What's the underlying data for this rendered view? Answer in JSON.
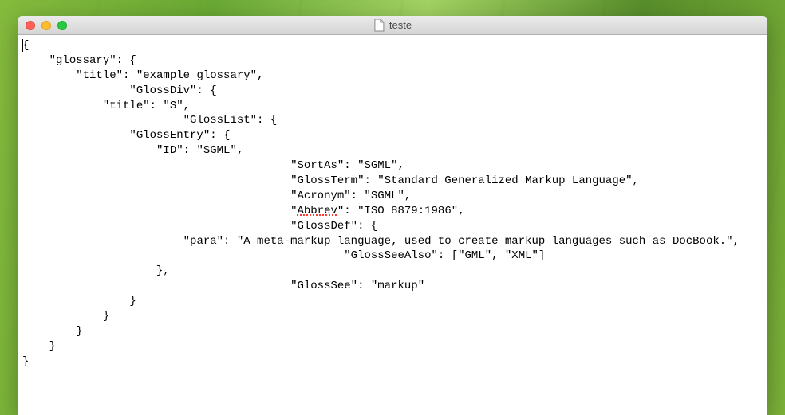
{
  "window": {
    "title": "teste"
  },
  "editor": {
    "lines": [
      "{",
      "    \"glossary\": {",
      "        \"title\": \"example glossary\",",
      "\t\t\"GlossDiv\": {",
      "            \"title\": \"S\",",
      "\t\t\t\"GlossList\": {",
      "                \"GlossEntry\": {",
      "                    \"ID\": \"SGML\",",
      "\t\t\t\t\t\"SortAs\": \"SGML\",",
      "\t\t\t\t\t\"GlossTerm\": \"Standard Generalized Markup Language\",",
      "\t\t\t\t\t\"Acronym\": \"SGML\",",
      "\t\t\t\t\t\"Abbrev\": \"ISO 8879:1986\",",
      "\t\t\t\t\t\"GlossDef\": {",
      "                        \"para\": \"A meta-markup language, used to create markup languages such as DocBook.\",",
      "\t\t\t\t\t\t\"GlossSeeAlso\": [\"GML\", \"XML\"]",
      "                    },",
      "\t\t\t\t\t\"GlossSee\": \"markup\"",
      "                }",
      "            }",
      "        }",
      "    }",
      "}"
    ],
    "l0": "{",
    "l1": "    \"glossary\": {",
    "l2": "        \"title\": \"example glossary\",",
    "l3": "\t\t\"GlossDiv\": {",
    "l4": "            \"title\": \"S\",",
    "l5": "\t\t\t\"GlossList\": {",
    "l6": "                \"GlossEntry\": {",
    "l7": "                    \"ID\": \"SGML\",",
    "l8": "\t\t\t\t\t\"SortAs\": \"SGML\",",
    "l9": "\t\t\t\t\t\"GlossTerm\": \"Standard Generalized Markup Language\",",
    "l10": "\t\t\t\t\t\"Acronym\": \"SGML\",",
    "l11a": "\t\t\t\t\t\"",
    "l11b": "Abbrev",
    "l11c": "\": \"ISO 8879:1986\",",
    "l12": "\t\t\t\t\t\"GlossDef\": {",
    "l13": "                        \"para\": \"A meta-markup language, used to create markup languages such as DocBook.\",",
    "l14": "\t\t\t\t\t\t\"GlossSeeAlso\": [\"GML\", \"XML\"]",
    "l15": "                    },",
    "l16": "\t\t\t\t\t\"GlossSee\": \"markup\"",
    "l17": "                }",
    "l18": "            }",
    "l19": "        }",
    "l20": "    }",
    "l21": "}"
  }
}
